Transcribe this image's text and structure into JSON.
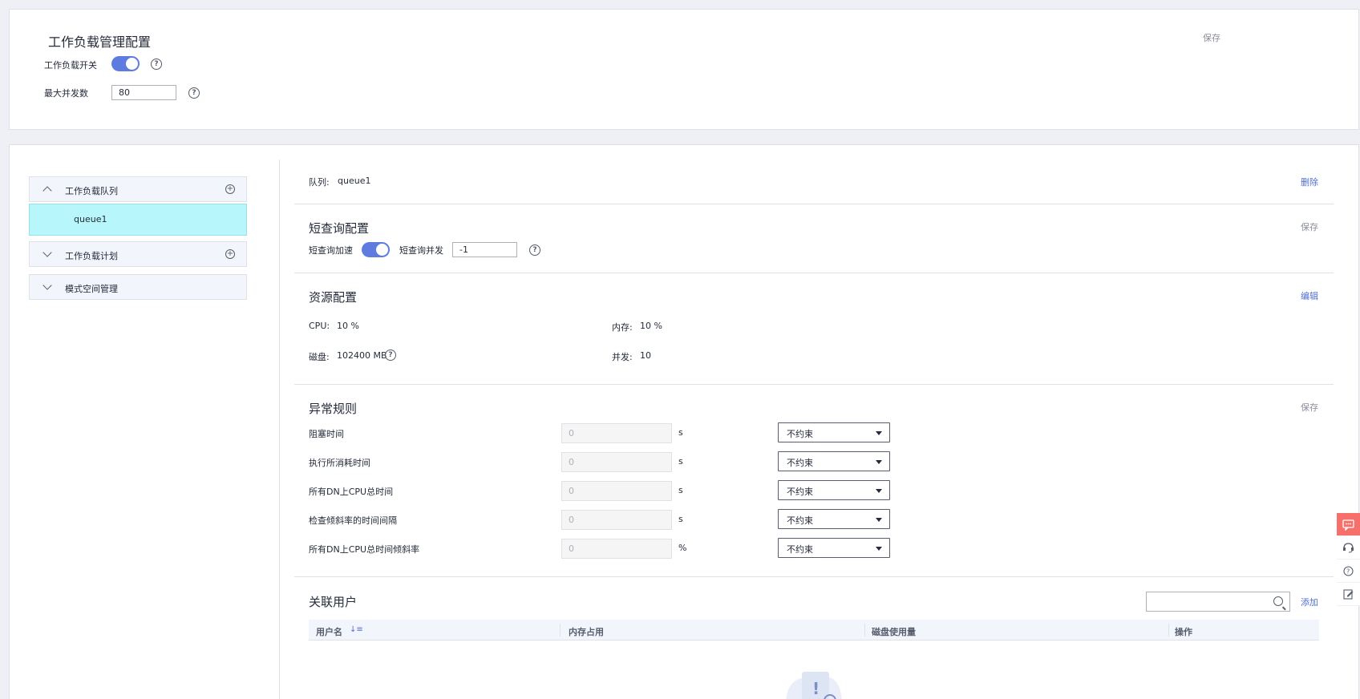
{
  "workload_config": {
    "title": "工作负载管理配置",
    "save": "保存",
    "switch_label": "工作负载开关",
    "max_concurrency_label": "最大并发数",
    "max_concurrency_value": "80"
  },
  "tree": {
    "groups": [
      {
        "label": "工作负载队列",
        "expanded": true,
        "items": [
          "queue1"
        ]
      },
      {
        "label": "工作负载计划",
        "expanded": false
      },
      {
        "label": "模式空间管理",
        "expanded": false
      }
    ]
  },
  "queue": {
    "label": "队列:",
    "name": "queue1",
    "delete": "删除"
  },
  "short_query": {
    "title": "短查询配置",
    "save": "保存",
    "accel_label": "短查询加速",
    "concurrency_label": "短查询并发",
    "concurrency_value": "-1"
  },
  "resource": {
    "title": "资源配置",
    "edit": "编辑",
    "cpu_label": "CPU:",
    "cpu_value": "10 %",
    "mem_label": "内存:",
    "mem_value": "10 %",
    "disk_label": "磁盘:",
    "disk_value": "102400 MB",
    "conc_label": "并发:",
    "conc_value": "10"
  },
  "exception_rules": {
    "title": "异常规则",
    "save": "保存",
    "rows": [
      {
        "label": "阻塞时间",
        "value": "0",
        "unit": "s",
        "action": "不约束"
      },
      {
        "label": "执行所消耗时间",
        "value": "0",
        "unit": "s",
        "action": "不约束"
      },
      {
        "label": "所有DN上CPU总时间",
        "value": "0",
        "unit": "s",
        "action": "不约束"
      },
      {
        "label": "检查倾斜率的时间间隔",
        "value": "0",
        "unit": "s",
        "action": "不约束"
      },
      {
        "label": "所有DN上CPU总时间倾斜率",
        "value": "0",
        "unit": "%",
        "action": "不约束"
      }
    ]
  },
  "users": {
    "title": "关联用户",
    "add": "添加",
    "search_value": "",
    "columns": [
      "用户名",
      "内存占用",
      "磁盘使用量",
      "操作"
    ]
  },
  "colors": {
    "accent": "#5e7ce0",
    "link": "#526ecc",
    "selected_row": "#b7f6fb",
    "feedback": "#f66f6a"
  },
  "icons": {
    "help": "help-circle-icon",
    "add": "add-circle-icon",
    "search": "search-icon",
    "sort": "sort-icon",
    "side_tools": [
      "feedback-icon",
      "service-icon",
      "help-icon",
      "edit-note-icon"
    ]
  }
}
